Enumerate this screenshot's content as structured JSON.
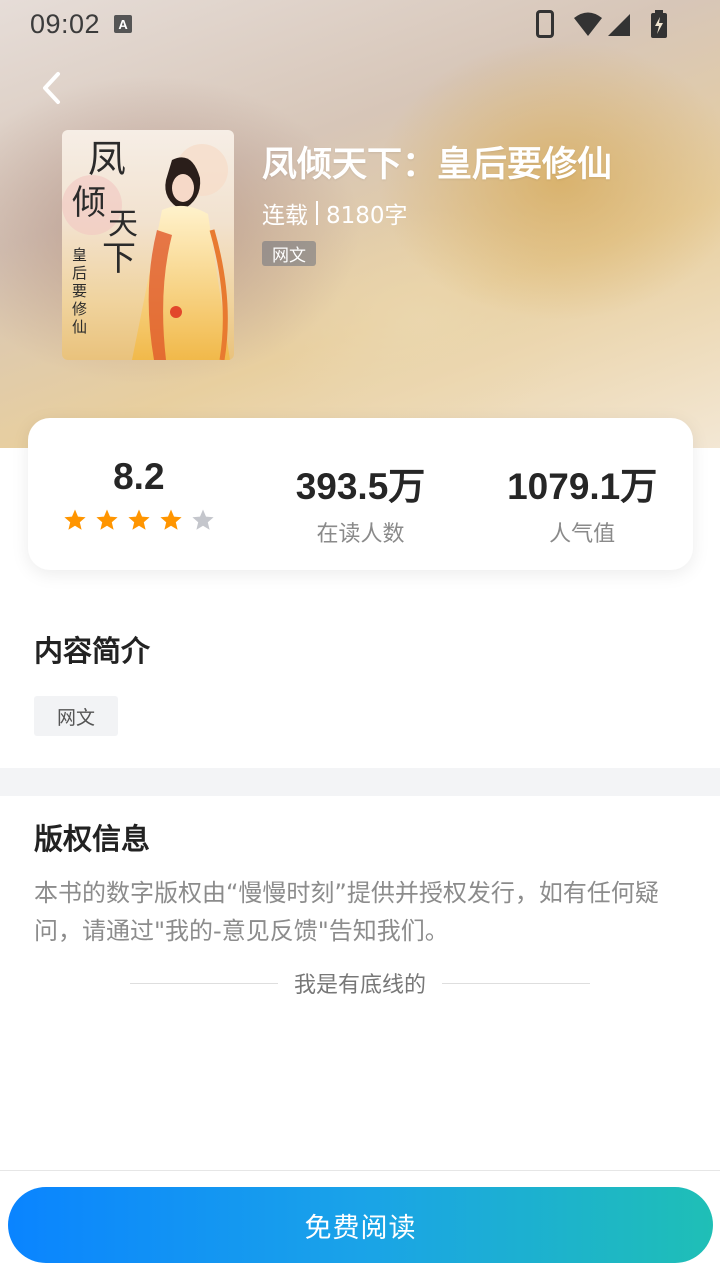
{
  "status_bar": {
    "time": "09:02",
    "a_badge": "A"
  },
  "book": {
    "title": "凤倾天下：皇后要修仙",
    "status": "连载",
    "word_count": "8180字",
    "tag": "网文",
    "cover_title": "凤倾天下",
    "cover_subtitle": "皇后要修仙"
  },
  "stats": {
    "rating": "8.2",
    "rating_stars": 4,
    "rating_stars_max": 5,
    "readers_value": "393.5万",
    "readers_label": "在读人数",
    "popularity_value": "1079.1万",
    "popularity_label": "人气值"
  },
  "intro": {
    "title": "内容简介",
    "tag": "网文"
  },
  "copyright": {
    "title": "版权信息",
    "text": "本书的数字版权由“慢慢时刻”提供并授权发行，如有任何疑问，请通过\"我的-意见反馈\"告知我们。",
    "bottom_line": "我是有底线的"
  },
  "action": {
    "read_button": "免费阅读"
  },
  "colors": {
    "star_filled": "#ff9500",
    "star_empty": "#c4c6cc",
    "button_start": "#0a84ff",
    "button_end": "#1fbfb6"
  }
}
